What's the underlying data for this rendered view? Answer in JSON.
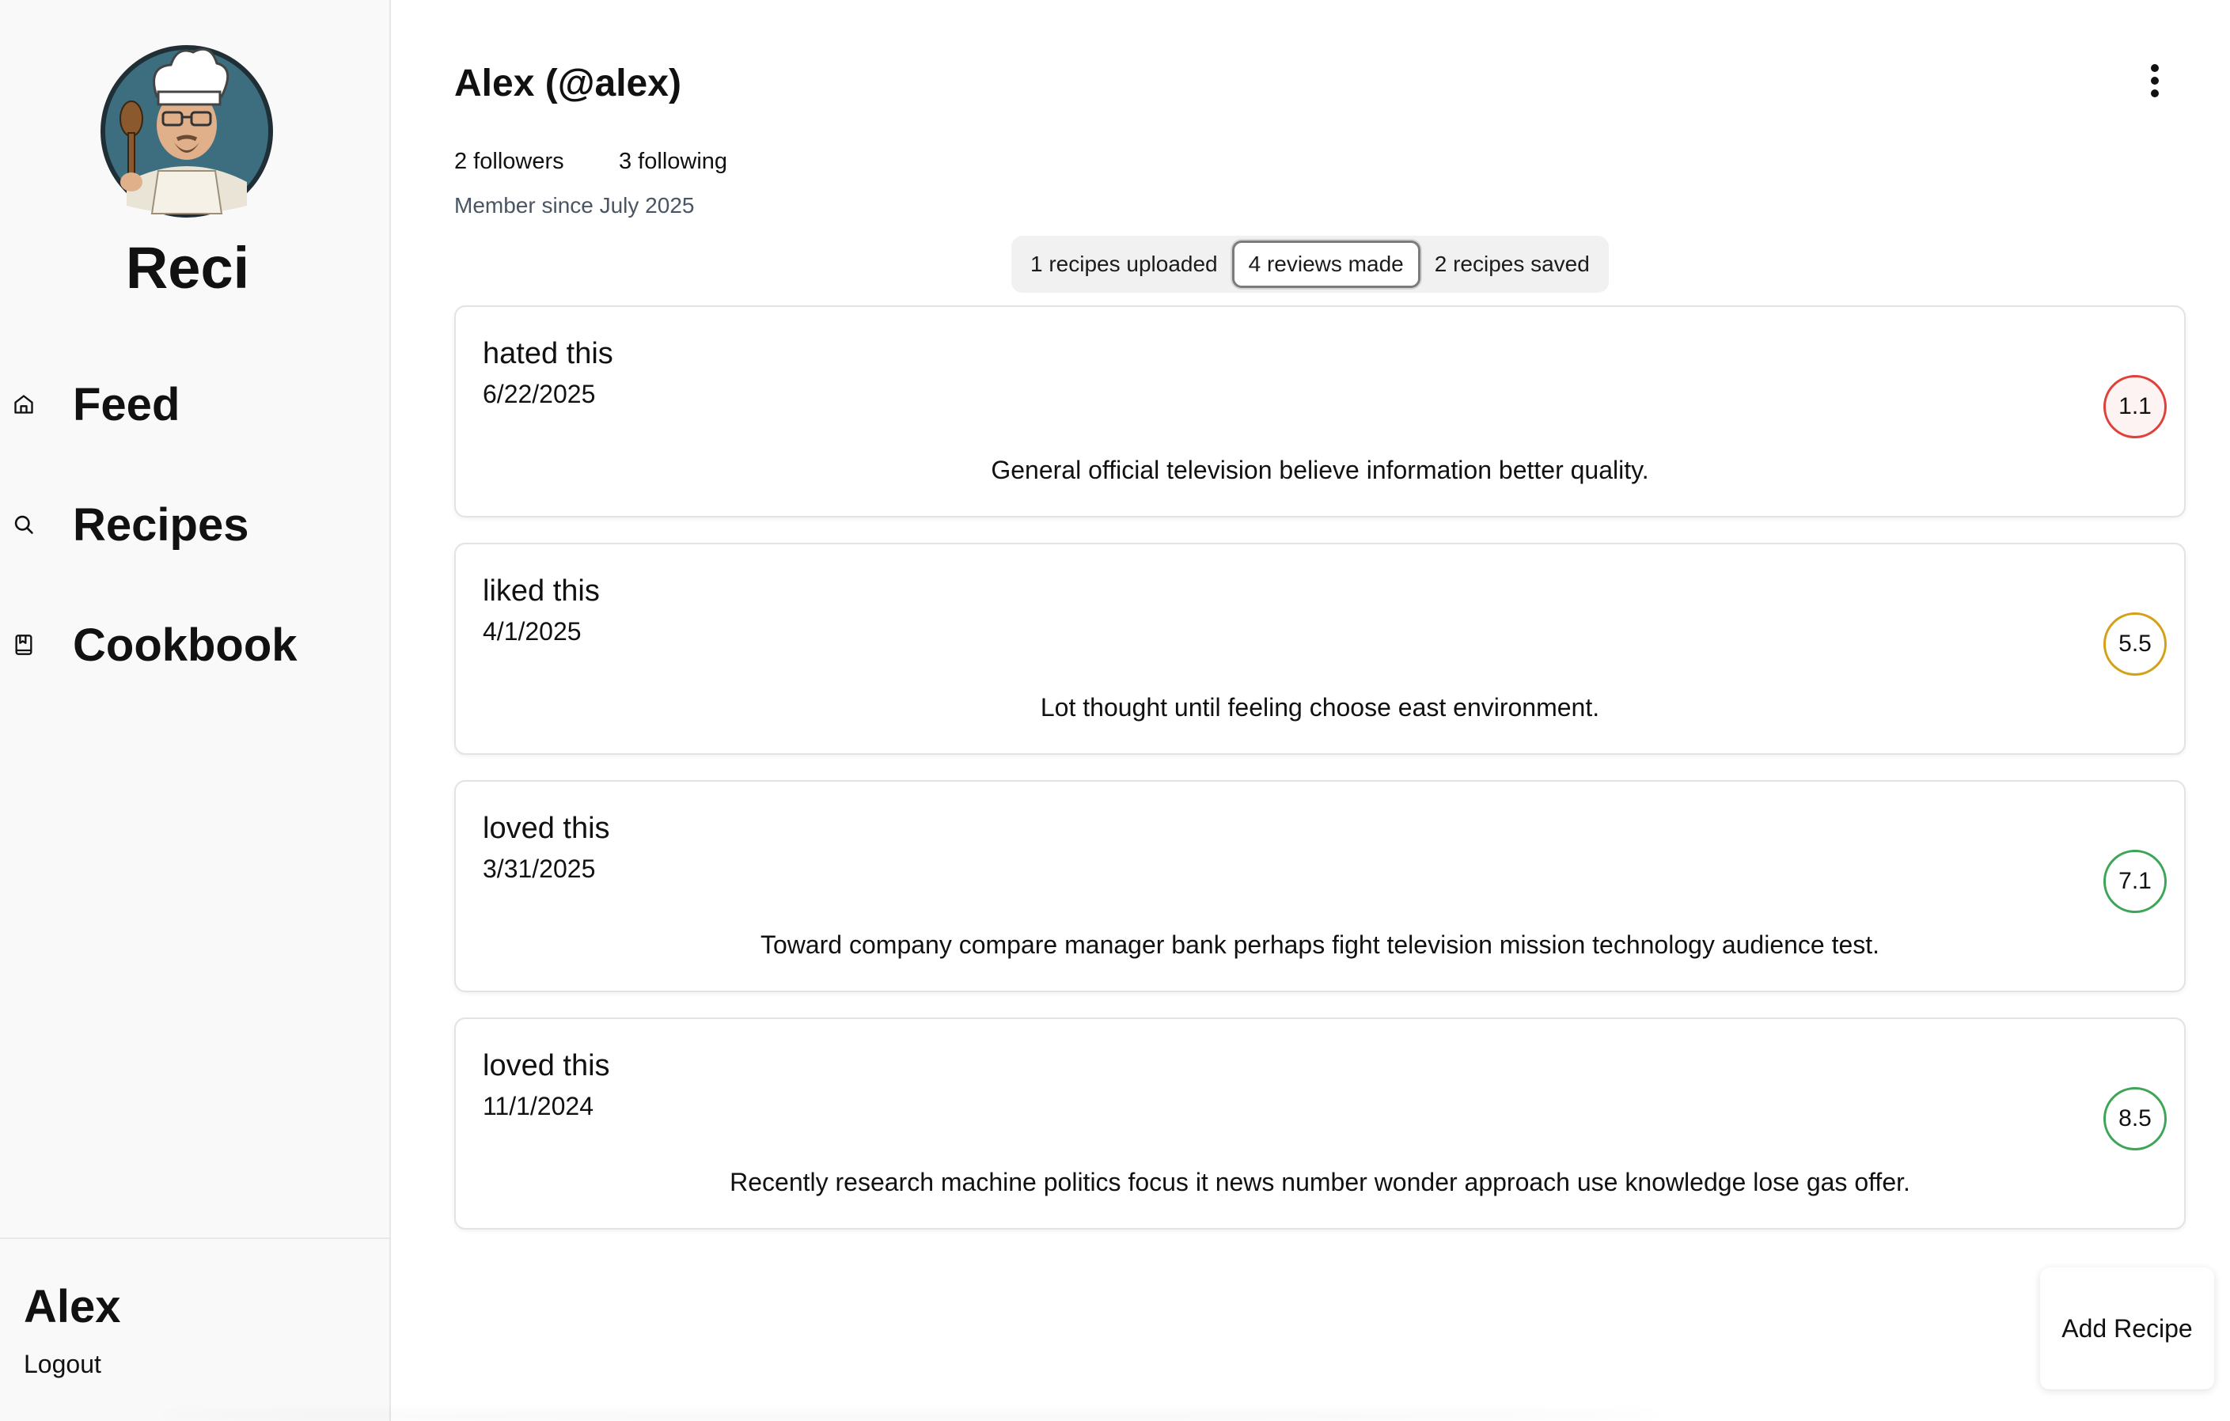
{
  "sidebar": {
    "brand": "Reci",
    "nav": [
      {
        "label": "Feed",
        "icon": "home-icon"
      },
      {
        "label": "Recipes",
        "icon": "search-icon"
      },
      {
        "label": "Cookbook",
        "icon": "bookmark-book-icon"
      }
    ],
    "user_name": "Alex",
    "logout_label": "Logout"
  },
  "profile": {
    "name": "Alex (@alex)",
    "followers": "2 followers",
    "following": "3 following",
    "member_since": "Member since July 2025"
  },
  "tabs": [
    {
      "label": "1 recipes uploaded",
      "active": false
    },
    {
      "label": "4 reviews made",
      "active": true
    },
    {
      "label": "2 recipes saved",
      "active": false
    }
  ],
  "reviews": [
    {
      "verdict": "hated this",
      "date": "6/22/2025",
      "text": "General official television believe information better quality.",
      "rating": "1.1",
      "rating_color": "#e0403a",
      "rating_bg": "#fdf3f3"
    },
    {
      "verdict": "liked this",
      "date": "4/1/2025",
      "text": "Lot thought until feeling choose east environment.",
      "rating": "5.5",
      "rating_color": "#d4a017",
      "rating_bg": "#ffffff"
    },
    {
      "verdict": "loved this",
      "date": "3/31/2025",
      "text": "Toward company compare manager bank perhaps fight television mission technology audience test.",
      "rating": "7.1",
      "rating_color": "#3ea558",
      "rating_bg": "#ffffff"
    },
    {
      "verdict": "loved this",
      "date": "11/1/2024",
      "text": "Recently research machine politics focus it news number wonder approach use knowledge lose gas offer.",
      "rating": "8.5",
      "rating_color": "#3ea558",
      "rating_bg": "#ffffff"
    }
  ],
  "actions": {
    "add_recipe_label": "Add Recipe"
  },
  "colors": {
    "sidebar_bg": "#f9f9f9",
    "text": "#111111",
    "muted": "#4a5563"
  }
}
